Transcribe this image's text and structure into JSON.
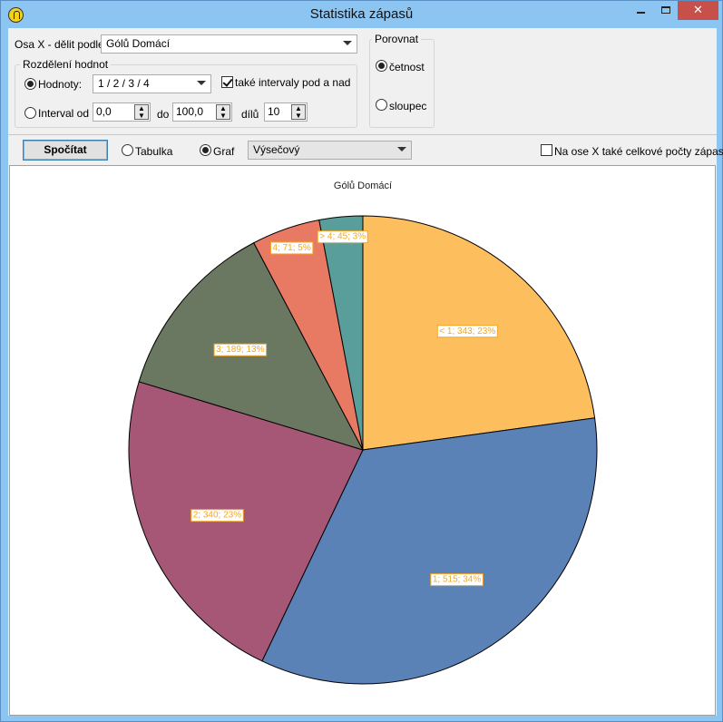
{
  "window": {
    "title": "Statistika zápasů"
  },
  "controls": {
    "osa_x_label": "Osa X - dělit podle",
    "osa_x_value": "Gólů Domácí",
    "rozdeleni_title": "Rozdělení hodnot",
    "hodnoty_label": "Hodnoty:",
    "hodnoty_value": "1 / 2 / 3 / 4",
    "intervaly_label": "také intervaly pod a nad",
    "interval_label": "Interval od",
    "interval_from": "0,0",
    "do_label": "do",
    "interval_to": "100,0",
    "dilu_label": "dílů",
    "dilu_value": "10",
    "porovnat_title": "Porovnat",
    "cetnost_label": "četnost",
    "sloupec_label": "sloupec",
    "spocitat_label": "Spočítat",
    "tabulka_label": "Tabulka",
    "graf_label": "Graf",
    "graf_type": "Výsečový",
    "celkove_label": "Na ose X také celkové počty zápasů"
  },
  "chart_data": {
    "type": "pie",
    "title": "Gólů Domácí",
    "slices": [
      {
        "label": "< 1; 343; 23%",
        "category": "< 1",
        "value": 343,
        "percent": 23,
        "color": "#fdbe5e"
      },
      {
        "label": "1; 515; 34%",
        "category": "1",
        "value": 515,
        "percent": 34,
        "color": "#5a82b6"
      },
      {
        "label": "2; 340; 23%",
        "category": "2",
        "value": 340,
        "percent": 23,
        "color": "#a55775"
      },
      {
        "label": "3; 189; 13%",
        "category": "3",
        "value": 189,
        "percent": 13,
        "color": "#6a7862"
      },
      {
        "label": "4; 71; 5%",
        "category": "4",
        "value": 71,
        "percent": 5,
        "color": "#e87a63"
      },
      {
        "label": "> 4; 45; 3%",
        "category": "> 4",
        "value": 45,
        "percent": 3,
        "color": "#5a9e9b"
      }
    ],
    "label_color": "#f5a623"
  }
}
